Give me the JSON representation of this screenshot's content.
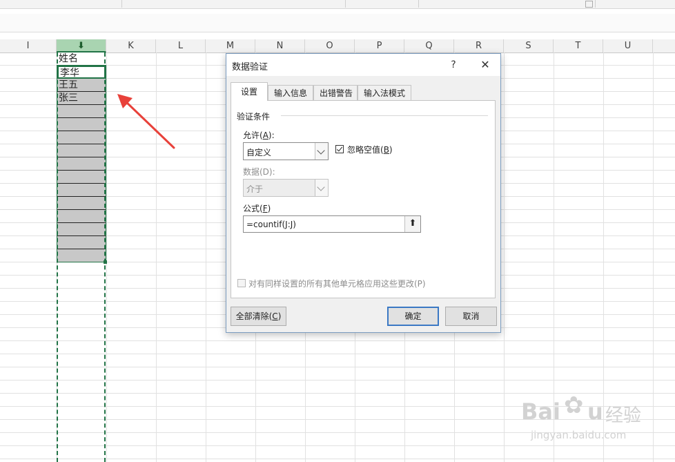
{
  "columns": [
    "I",
    "J",
    "K",
    "L",
    "M",
    "N",
    "O",
    "P",
    "Q",
    "R",
    "S",
    "T",
    "U"
  ],
  "selected_column": "J",
  "column_j_cells": [
    "姓名",
    "李华",
    "王五",
    "张三"
  ],
  "dialog": {
    "title": "数据验证",
    "help_label": "?",
    "close_label": "✕",
    "tabs": [
      "设置",
      "输入信息",
      "出错警告",
      "输入法模式"
    ],
    "section_title": "验证条件",
    "allow_label": "允许(",
    "allow_key": "A",
    "allow_suffix": "):",
    "allow_value": "自定义",
    "ignore_blank_label": "忽略空值(",
    "ignore_blank_key": "B",
    "ignore_blank_suffix": ")",
    "ignore_blank_checked": true,
    "data_label": "数据(D):",
    "data_value": "介于",
    "formula_label": "公式(",
    "formula_key": "F",
    "formula_suffix": ")",
    "formula_value": "=countif(J:J)",
    "apply_all_label": "对有同样设置的所有其他单元格应用这些更改(P)",
    "apply_all_checked": false,
    "clear_all_label": "全部清除(",
    "clear_all_key": "C",
    "clear_all_suffix": ")",
    "ok_label": "确定",
    "cancel_label": "取消"
  },
  "colors": {
    "excel_green": "#217346",
    "selected_header": "#a9d4b1",
    "arrow": "#e8413a"
  },
  "watermark": {
    "brand_left": "Bai",
    "brand_right": "u",
    "brand_cn": "经验",
    "url": "jingyan.baidu.com"
  }
}
